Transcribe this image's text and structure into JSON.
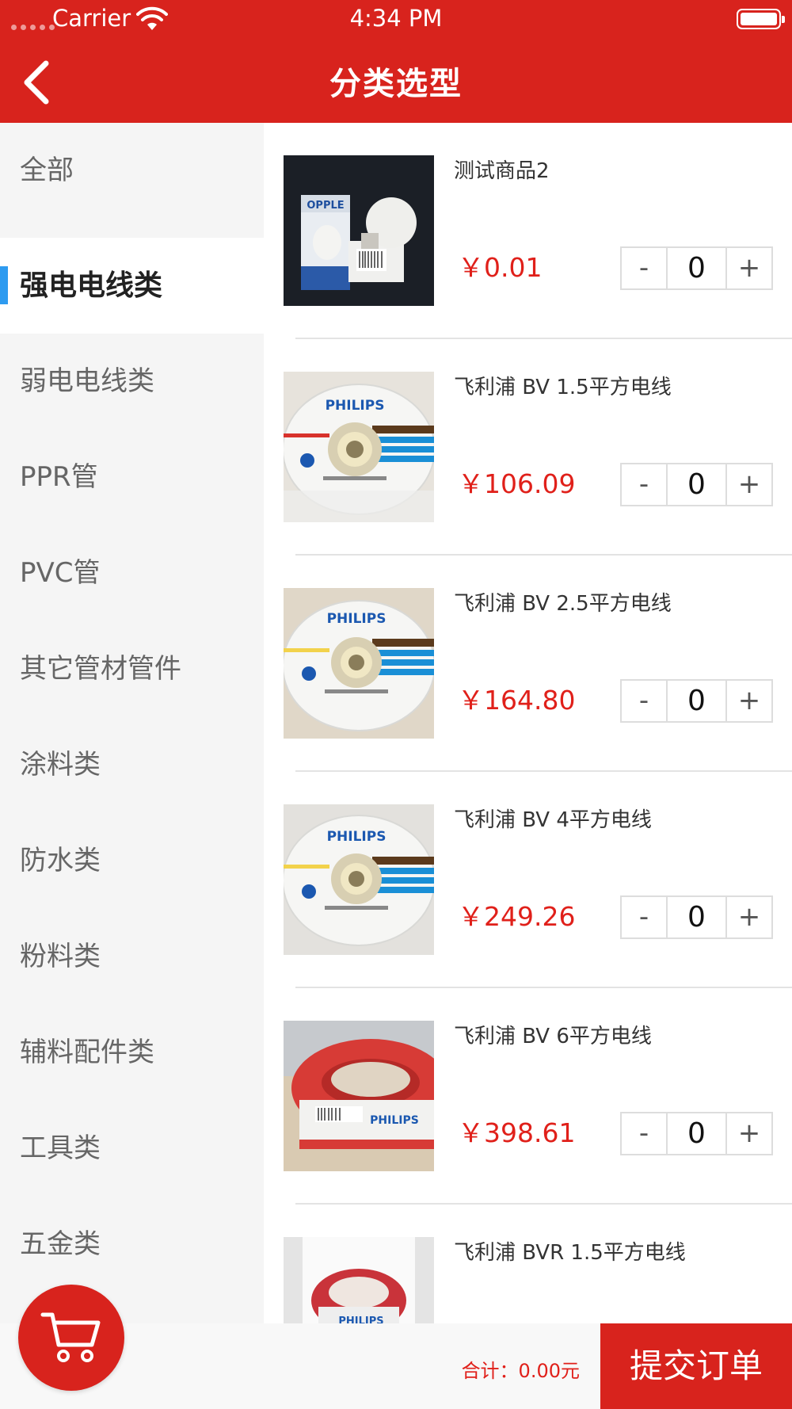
{
  "status_bar": {
    "carrier": "Carrier",
    "time": "4:34 PM"
  },
  "nav": {
    "title": "分类选型",
    "back_icon": "chevron-left-icon"
  },
  "categories": [
    {
      "label": "全部",
      "active": false
    },
    {
      "label": "强电电线类",
      "active": true
    },
    {
      "label": "弱电电线类",
      "active": false
    },
    {
      "label": "PPR管",
      "active": false
    },
    {
      "label": "PVC管",
      "active": false
    },
    {
      "label": "其它管材管件",
      "active": false
    },
    {
      "label": "涂料类",
      "active": false
    },
    {
      "label": "防水类",
      "active": false
    },
    {
      "label": "粉料类",
      "active": false
    },
    {
      "label": "辅料配件类",
      "active": false
    },
    {
      "label": "工具类",
      "active": false
    },
    {
      "label": "五金类",
      "active": false
    }
  ],
  "products": [
    {
      "name": "测试商品2",
      "price": "￥0.01",
      "qty": "0",
      "image": "opple-led-bulb"
    },
    {
      "name": "飞利浦 BV 1.5平方电线",
      "price": "￥106.09",
      "qty": "0",
      "image": "philips-wire-coil"
    },
    {
      "name": "飞利浦 BV 2.5平方电线",
      "price": "￥164.80",
      "qty": "0",
      "image": "philips-wire-coil"
    },
    {
      "name": "飞利浦 BV 4平方电线",
      "price": "￥249.26",
      "qty": "0",
      "image": "philips-wire-coil"
    },
    {
      "name": "飞利浦 BV 6平方电线",
      "price": "￥398.61",
      "qty": "0",
      "image": "red-wire-coil"
    },
    {
      "name": "飞利浦 BVR 1.5平方电线",
      "price": "",
      "qty": "",
      "image": "red-wire-coil"
    }
  ],
  "stepper": {
    "minus": "-",
    "plus": "+"
  },
  "bottom": {
    "total": "合计：0.00元",
    "submit": "提交订单",
    "cart_icon": "cart-icon"
  },
  "colors": {
    "brand_red": "#d8231d",
    "price_red": "#e0201a",
    "active_marker": "#2e9bf0",
    "sidebar_bg": "#f5f5f5"
  }
}
